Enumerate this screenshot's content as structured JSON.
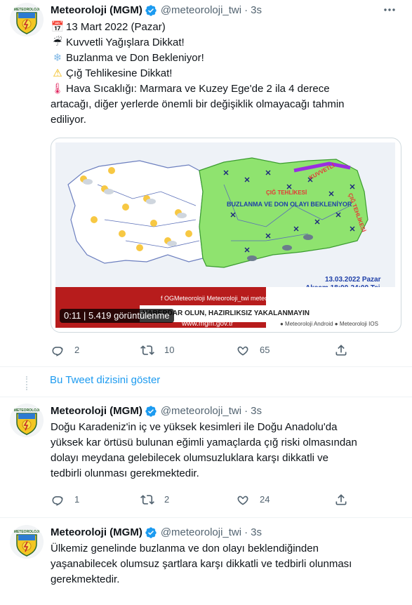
{
  "tweets": [
    {
      "display_name": "Meteoroloji (MGM)",
      "handle": "@meteoroloji_twi",
      "separator": "·",
      "time": "3s",
      "lines": [
        {
          "emoji": "calendar-icon",
          "glyph": "📅",
          "text": "13 Mart 2022 (Pazar)"
        },
        {
          "emoji": "umbrella-icon",
          "glyph": "☔",
          "text": "Kuvvetli Yağışlara Dikkat!"
        },
        {
          "emoji": "snowflake-icon",
          "glyph": "❄",
          "text": "Buzlanma ve Don Bekleniyor!"
        },
        {
          "emoji": "warning-icon",
          "glyph": "⚠",
          "text": "Çığ Tehlikesine Dikkat!"
        },
        {
          "emoji": "thermometer-icon",
          "glyph": "🌡",
          "text": "Hava Sıcaklığı: Marmara ve Kuzey Ege'de 2 ila 4 derece"
        },
        {
          "emoji": "",
          "glyph": "",
          "text": "artacağı, diğer yerlerde önemli bir değişiklik olmayacağı tahmin"
        },
        {
          "emoji": "",
          "glyph": "",
          "text": "ediliyor."
        }
      ],
      "media": {
        "video_time": "0:11",
        "views": "5.419 görüntülenme",
        "map_date": "13.03.2022 Pazar",
        "map_time": "Akşam 18:00-24:00 Tsi",
        "frost_label": "BUZLANMA VE DON OLAYI BEKLENİYOR",
        "warn_heavy": "KUVVETLİ",
        "warn_avalanche": "ÇIĞ TEHLİKESİ",
        "warn_rain": "ÇIĞ TEHLİKESİ",
        "social": "f OGMeteoroloji   Meteoroloji_twi   meteoroloji_ins",
        "slogan": "HABERDAR OLUN, HAZIRLIKSIZ YAKALANMAYIN",
        "url": "www.mgm.gov.tr",
        "apps": "● Meteoroloji Android   ● Meteoroloji IOS"
      },
      "replies": "2",
      "retweets": "10",
      "likes": "65"
    },
    {
      "display_name": "Meteoroloji (MGM)",
      "handle": "@meteoroloji_twi",
      "separator": "·",
      "time": "3s",
      "lines": [
        {
          "text": "Doğu Karadeniz'in iç ve yüksek kesimleri ile Doğu Anadolu'da"
        },
        {
          "text": "yüksek kar örtüsü bulunan eğimli yamaçlarda çığ riski olmasından"
        },
        {
          "text": "dolayı meydana gelebilecek olumsuzluklara karşı dikkatli ve"
        },
        {
          "text": "tedbirli olunması gerekmektedir."
        }
      ],
      "replies": "1",
      "retweets": "2",
      "likes": "24"
    },
    {
      "display_name": "Meteoroloji (MGM)",
      "handle": "@meteoroloji_twi",
      "separator": "·",
      "time": "3s",
      "lines": [
        {
          "text": "Ülkemiz genelinde buzlanma ve don olayı beklendiğinden"
        },
        {
          "text": "yaşanabilecek olumsuz şartlara karşı dikkatli ve tedbirli olunması"
        },
        {
          "text": "gerekmektedir."
        }
      ]
    }
  ],
  "show_thread": "Bu Tweet dizisini göster",
  "avatar_text": "METEOROLOJİ",
  "colors": {
    "accent": "#1d9bf0",
    "muted": "#536471",
    "verified": "#1d9bf0"
  }
}
